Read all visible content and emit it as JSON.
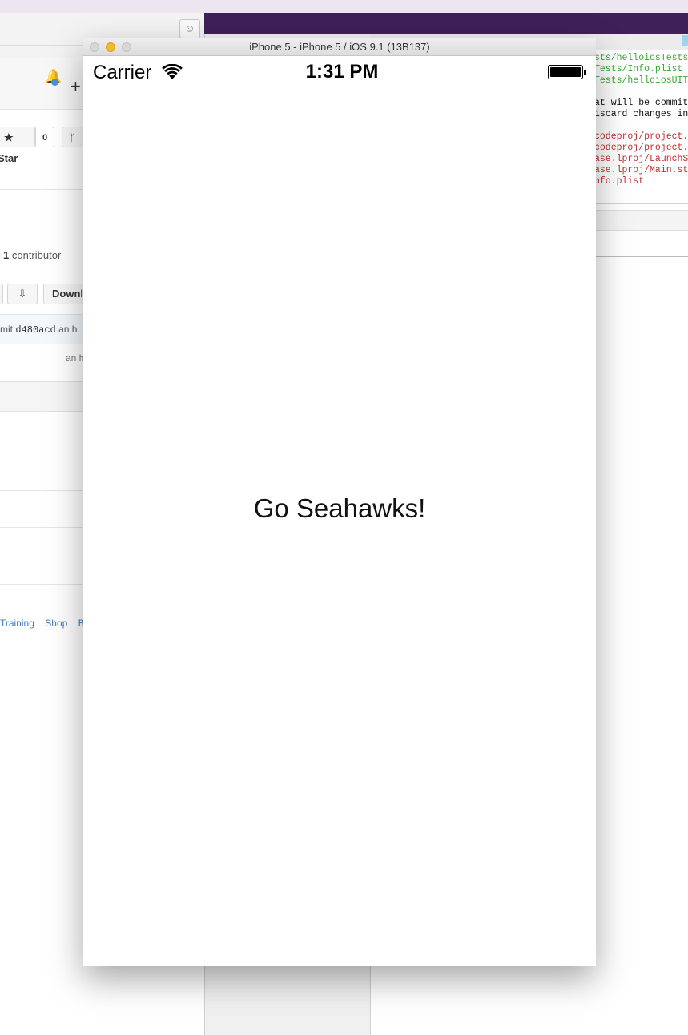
{
  "simulator": {
    "window_title": "iPhone 5 - iPhone 5 / iOS 9.1 (13B137)",
    "carrier": "Carrier",
    "time": "1:31 PM",
    "battery_level": 1.0,
    "label": "Go Seahawks!"
  },
  "github": {
    "star_label": "Star",
    "star_count": "0",
    "contributors_count": "1",
    "contributors_label": "contributor",
    "download_label": "Downl",
    "commit_prefix": "mit",
    "commit_sha": "d480acd",
    "commit_msg": "an h",
    "commit_author_fragment": "an h",
    "footer_links": [
      "Training",
      "Shop",
      "Bl"
    ]
  },
  "terminal": {
    "lines": [
      {
        "text": "sts/helloiosTests",
        "color": "green"
      },
      {
        "text": "Tests/Info.plist",
        "color": "green"
      },
      {
        "text": "Tests/helloiosUIT",
        "color": "green"
      },
      {
        "text": "",
        "color": "black"
      },
      {
        "text": "at will be commit",
        "color": "black"
      },
      {
        "text": "iscard changes in",
        "color": "black"
      },
      {
        "text": "",
        "color": "black"
      },
      {
        "text": "codeproj/project.",
        "color": "red"
      },
      {
        "text": "codeproj/project.",
        "color": "red"
      },
      {
        "text": "ase.lproj/LaunchS",
        "color": "red"
      },
      {
        "text": "ase.lproj/Main.st",
        "color": "red"
      },
      {
        "text": "nfo.plist",
        "color": "red"
      }
    ]
  },
  "colors": {
    "menubar": "#ece6f0",
    "purple_bar": "#3f2058",
    "terminal_green": "#3aa63a",
    "terminal_red": "#c03030",
    "link_blue": "#4078c0",
    "traffic_yellow": "#f4b92f"
  }
}
